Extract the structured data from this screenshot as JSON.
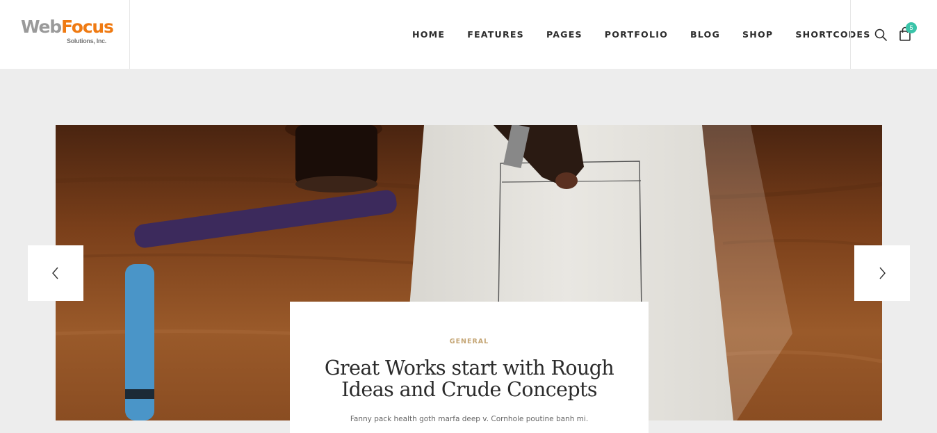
{
  "logo": {
    "part1": "Web",
    "part2": "Focus",
    "tagline": "Solutions, Inc."
  },
  "nav": {
    "items": [
      "HOME",
      "FEATURES",
      "PAGES",
      "PORTFOLIO",
      "BLOG",
      "SHOP",
      "SHORTCODES"
    ]
  },
  "cart": {
    "count": "5"
  },
  "icons": {
    "search": "search-icon",
    "cart": "shopping-bag-icon",
    "prev": "chevron-left-icon",
    "next": "chevron-right-icon"
  },
  "colors": {
    "accent": "#3ac4a9",
    "category": "#c4a574",
    "logo_orange": "#ef7a12",
    "logo_gray": "#9a9a9a",
    "page_bg": "#ededed"
  },
  "slide": {
    "category": "GENERAL",
    "title": "Great Works start with Rough Ideas and Crude Concepts",
    "excerpt": "Fanny pack health goth marfa deep v. Cornhole poutine banh mi."
  }
}
